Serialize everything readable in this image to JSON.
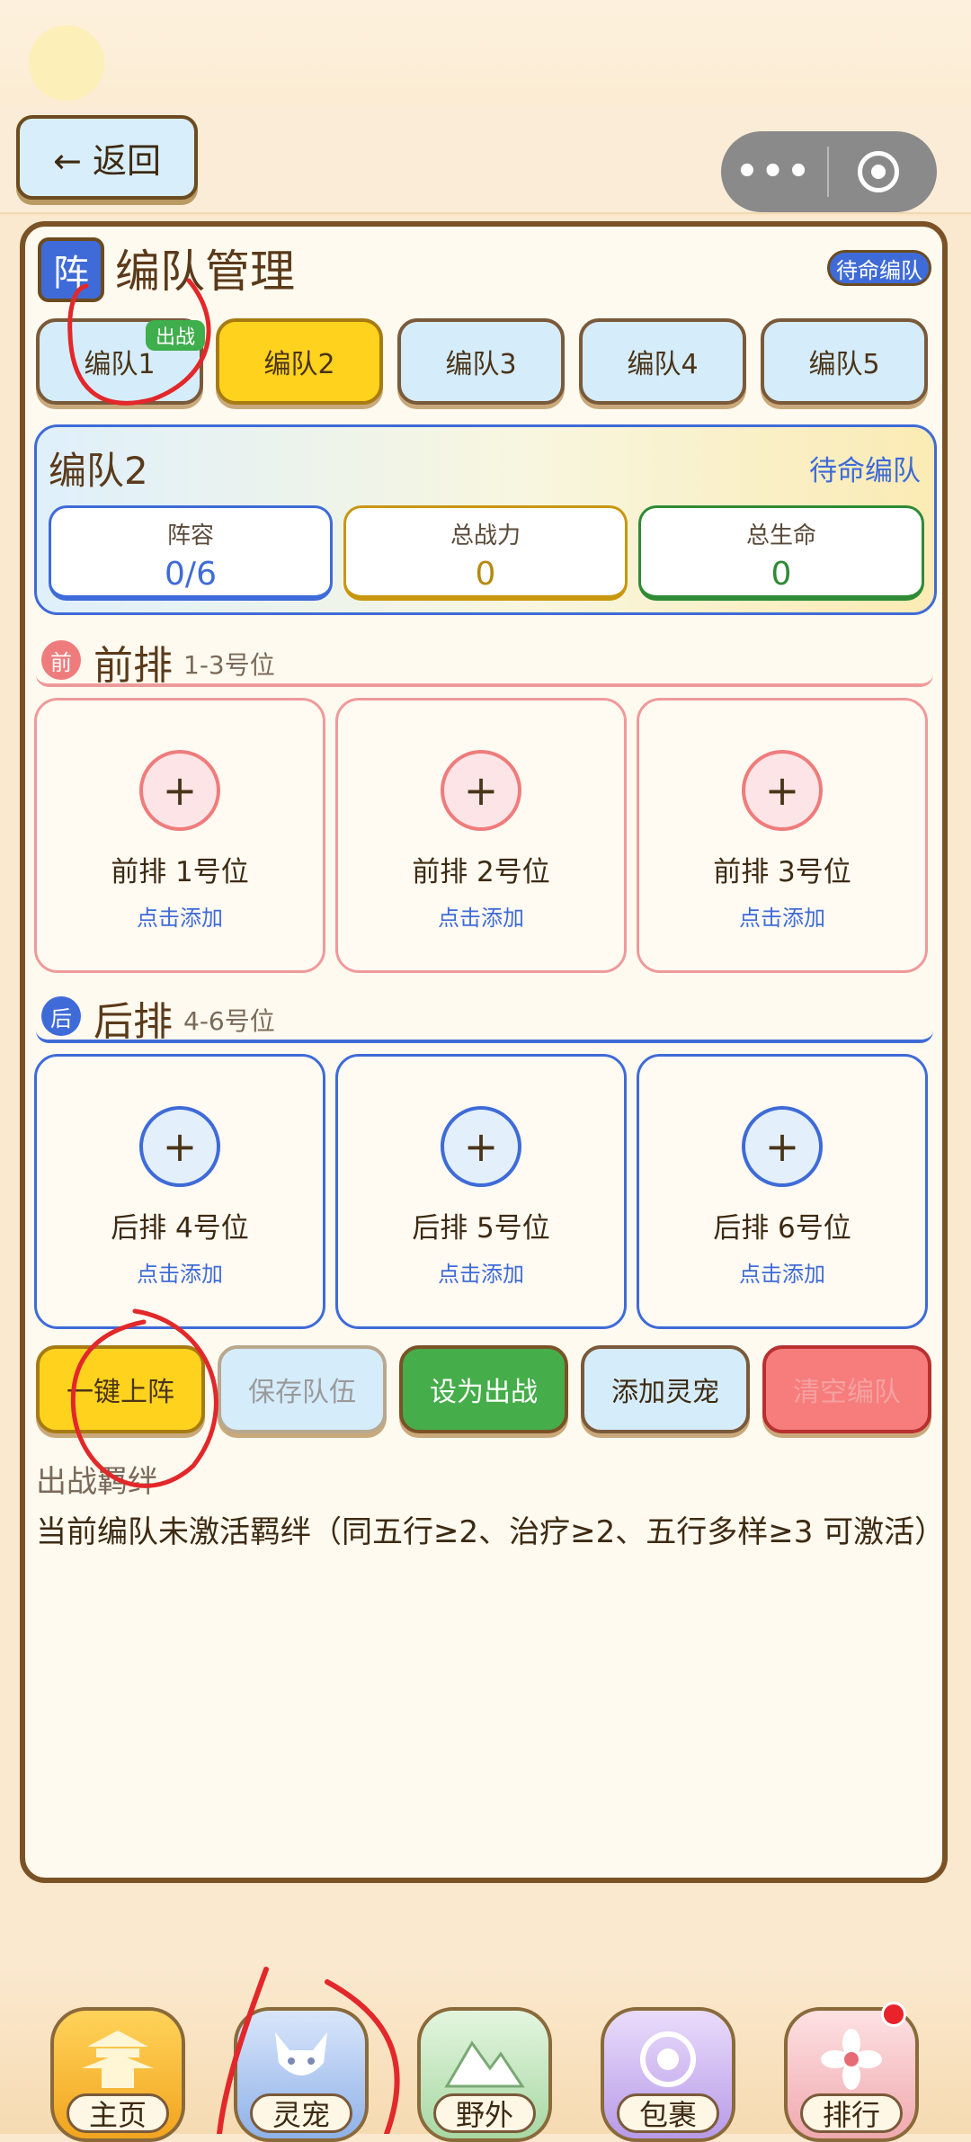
{
  "header": {
    "back_label": "← 返回",
    "capsule_more": "•••"
  },
  "panel": {
    "badge": "阵",
    "title": "编队管理",
    "status_pill": "待命编队"
  },
  "teams": {
    "tabs": [
      "编队1",
      "编队2",
      "编队3",
      "编队4",
      "编队5"
    ],
    "active_index": 1,
    "deployed_badge": "出战"
  },
  "summary": {
    "title": "编队2",
    "status": "待命编队",
    "lineup_label": "阵容",
    "lineup_value": "0/6",
    "power_label": "总战力",
    "power_value": "0",
    "hp_label": "总生命",
    "hp_value": "0"
  },
  "front": {
    "badge": "前",
    "title": "前排",
    "subtitle": "1-3号位",
    "slots": [
      {
        "name": "前排 1号位",
        "add": "点击添加"
      },
      {
        "name": "前排 2号位",
        "add": "点击添加"
      },
      {
        "name": "前排 3号位",
        "add": "点击添加"
      }
    ]
  },
  "back": {
    "badge": "后",
    "title": "后排",
    "subtitle": "4-6号位",
    "slots": [
      {
        "name": "后排 4号位",
        "add": "点击添加"
      },
      {
        "name": "后排 5号位",
        "add": "点击添加"
      },
      {
        "name": "后排 6号位",
        "add": "点击添加"
      }
    ]
  },
  "actions": {
    "auto": "一键上阵",
    "save": "保存队伍",
    "deploy": "设为出战",
    "add_pet": "添加灵宠",
    "clear": "清空编队"
  },
  "bonds": {
    "title": "出战羁绊",
    "text": "当前编队未激活羁绊（同五行≥2、治疗≥2、五行多样≥3 可激活）"
  },
  "nav": {
    "items": [
      {
        "label": "主页",
        "icon": "pagoda-icon"
      },
      {
        "label": "灵宠",
        "icon": "fox-icon"
      },
      {
        "label": "野外",
        "icon": "mountain-icon"
      },
      {
        "label": "包裹",
        "icon": "bag-icon"
      },
      {
        "label": "排行",
        "icon": "flower-icon"
      }
    ]
  },
  "colors": {
    "accent_blue": "#3f6bd8",
    "gold": "#ffd21e",
    "green": "#45ad4a",
    "red": "#f77c7c",
    "brown": "#7a5226"
  }
}
